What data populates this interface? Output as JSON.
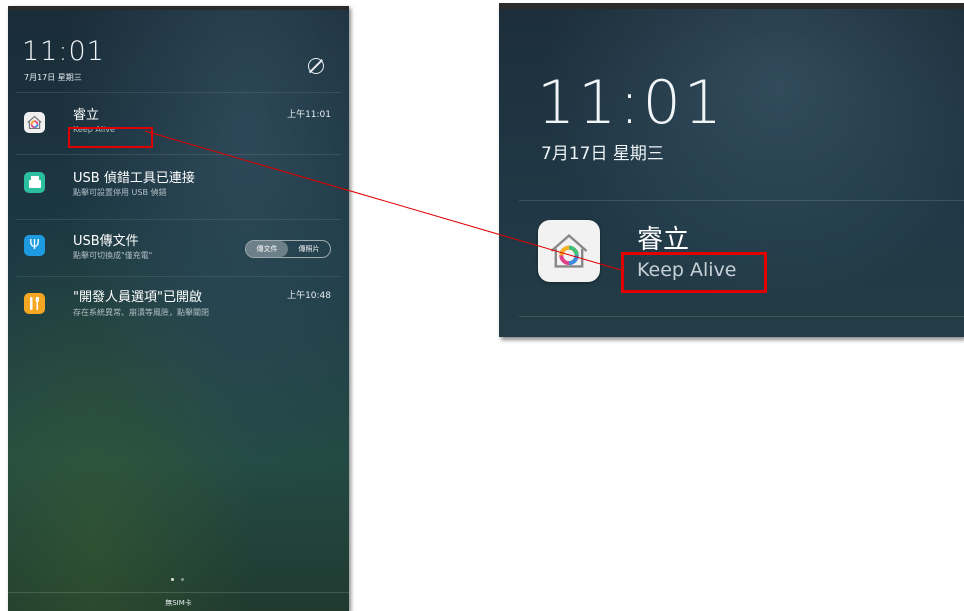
{
  "phone": {
    "clock": "11:01",
    "date": "7月17日 星期三",
    "notifications": [
      {
        "title": "睿立",
        "subtitle": "Keep Alive",
        "time": "上午11:01",
        "icon": "house-rainbow-icon"
      },
      {
        "title": "USB 偵錯工具已連接",
        "subtitle": "點擊可設置停用 USB 偵錯",
        "time": "",
        "icon": "usb-debug-icon"
      },
      {
        "title": "USB傳文件",
        "subtitle": "點擊可切換成\"僅充電\"",
        "time": "",
        "icon": "usb-icon",
        "toggle": {
          "option1": "傳文件",
          "option2": "傳照片",
          "selected": "傳文件"
        }
      },
      {
        "title": "\"開發人員選項\"已開啟",
        "subtitle": "存在系統異常、崩潰等風險，點擊關閉",
        "time": "上午10:48",
        "icon": "developer-tools-icon"
      }
    ],
    "page_indicator": {
      "count": 2,
      "active": 1
    },
    "carrier": "無SIM卡"
  },
  "zoom": {
    "clock": "11:01",
    "date": "7月17日 星期三",
    "notification": {
      "title": "睿立",
      "subtitle": "Keep Alive",
      "icon": "house-rainbow-icon"
    }
  },
  "colors": {
    "highlight": "#e00000",
    "usb_debug_icon_bg": "#2bbf9f",
    "usb_icon_bg": "#1e9be0",
    "developer_icon_bg": "#f5a623"
  }
}
